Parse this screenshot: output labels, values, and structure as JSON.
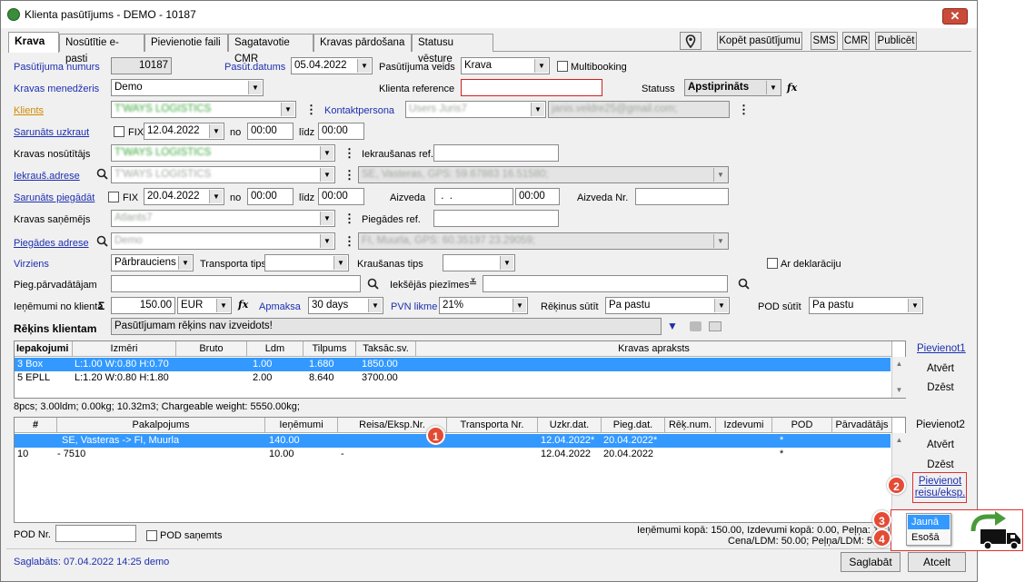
{
  "window": {
    "title": "Klienta pasūtījums - DEMO  - 10187",
    "close": "✕"
  },
  "tabs": [
    "Krava",
    "Nosūtītie e-pasti",
    "Pievienotie faili",
    "Sagatavotie CMR",
    "Kravas pārdošana",
    "Statusu vēsture"
  ],
  "toolbar": {
    "location_icon": "map-pin-icon",
    "copy": "Kopēt pasūtījumu",
    "sms": "SMS",
    "cmr": "CMR",
    "publish": "Publicēt"
  },
  "form": {
    "order_number_label": "Pasūtījuma numurs",
    "order_number": "10187",
    "order_date_label": "Pasūt.datums",
    "order_date": "05.04.2022",
    "order_type_label": "Pasūtījuma veids",
    "order_type": "Krava",
    "multibooking_label": "Multibooking",
    "manager_label": "Kravas menedžeris",
    "manager": "Demo",
    "client_ref_label": "Klienta reference",
    "client_ref": "",
    "status_label": "Statuss",
    "status": "Apstiprināts",
    "client_label": "Klients",
    "client": "T'WAYS LOGISTICS",
    "contact_label": "Kontaktpersona",
    "contact": "Users Juris7",
    "contact_email": "janis.veldre25@gmail.com;",
    "load_agreed_label": "Sarunāts uzkraut",
    "fix_label": "FIX",
    "load_date": "12.04.2022",
    "no_label": "no",
    "load_from": "00:00",
    "until_label": "līdz",
    "load_to": "00:00",
    "sender_label": "Kravas nosūtītājs",
    "sender": "T'WAYS LOGISTICS",
    "load_ref_label": "Iekraušanas ref.",
    "load_ref": "",
    "load_addr_label": "Iekrauš.adrese",
    "load_addr": "T'WAYS LOGISTICS",
    "load_addr_full": "SE, Vasteras, GPS: 59.67883 16.51580;",
    "deliver_agreed_label": "Sarunāts piegādāt",
    "deliver_date": "20.04.2022",
    "deliver_from": "00:00",
    "deliver_to": "00:00",
    "removed_label": "Aizveda",
    "removed_date": " .  .",
    "removed_time": "00:00",
    "removed_nr_label": "Aizveda Nr.",
    "removed_nr": "",
    "receiver_label": "Kravas saņēmējs",
    "receiver": "Atlants7",
    "delivery_ref_label": "Piegādes ref.",
    "delivery_ref": "",
    "delivery_addr_label": "Piegādes adrese",
    "delivery_addr": "Demo",
    "delivery_addr_full": "FI, Muurla, GPS: 60.35197 23.29059;",
    "direction_label": "Virziens",
    "direction": "Pārbrauciens",
    "transport_type_label": "Transporta tips",
    "transport_type": "",
    "loading_type_label": "Kraušanas tips",
    "loading_type": "",
    "declaration_label": "Ar deklarāciju",
    "carrier_label": "Pieg.pārvadātājam",
    "carrier": "",
    "internal_notes_label": "Iekšējās piezīmes",
    "internal_notes": "",
    "revenue_label": "Ieņēmumi no klienta",
    "sum_symbol": "Σ",
    "revenue": "150.00",
    "currency": "EUR",
    "fx": "fx",
    "payment_label": "Apmaksa",
    "payment": "30 days",
    "vat_label": "PVN likme",
    "vat": "21%",
    "invoice_send_label": "Rēķinus sūtīt",
    "invoice_send": "Pa pastu",
    "pod_send_label": "POD sūtīt",
    "pod_send": "Pa pastu",
    "invoice_label": "Rēķins klientam",
    "invoice_text": "Pasūtījumam rēķins nav izveidots!"
  },
  "packages": {
    "headers": [
      "Iepakojumi",
      "Izmēri",
      "Bruto",
      "Ldm",
      "Tilpums",
      "Taksāc.sv.",
      "Kravas apraksts"
    ],
    "rows": [
      [
        "3 Box",
        "L:1.00 W:0.80 H:0.70",
        "",
        "1.00",
        "1.680",
        "1850.00",
        ""
      ],
      [
        "5 EPLL",
        "L:1.20 W:0.80 H:1.80",
        "",
        "2.00",
        "8.640",
        "3700.00",
        ""
      ]
    ],
    "summary": "8pcs; 3.00ldm; 0.00kg; 10.32m3; Chargeable weight: 5550.00kg;",
    "add": "Pievienot1",
    "open": "Atvērt",
    "delete": "Dzēst"
  },
  "services": {
    "headers": [
      "#",
      "Pakalpojums",
      "Ieņēmumi",
      "Reisa/Eksp.Nr.",
      "Transporta Nr.",
      "Uzkr.dat.",
      "Pieg.dat.",
      "Rēķ.num.",
      "Izdevumi",
      "POD",
      "Pārvadātājs"
    ],
    "rows": [
      [
        "",
        "SE, Vasteras -> FI, Muurla",
        "140.00",
        "",
        "",
        "12.04.2022*",
        "20.04.2022*",
        "",
        "",
        "*",
        ""
      ],
      [
        "10",
        "- 7510",
        "10.00",
        "-",
        "",
        "12.04.2022",
        "20.04.2022",
        "",
        "",
        "*",
        ""
      ]
    ],
    "add": "Pievienot2",
    "open": "Atvērt",
    "delete": "Dzēst",
    "add_trip": "Pievienot reisu/eksp.",
    "menu_new": "Jaunā",
    "menu_existing": "Esošā"
  },
  "footer": {
    "pod_nr_label": "POD Nr.",
    "pod_nr": "",
    "pod_received_label": "POD saņemts",
    "totals1": "Ieņēmumi kopā: 150.00, Izdevumi kopā: 0.00, Peļņa: 150",
    "totals2": "Cena/LDM: 50.00; Peļņa/LDM: 50",
    "saved": "Saglabāts: 07.04.2022 14:25 demo",
    "save": "Saglabāt",
    "cancel": "Atcelt"
  },
  "badges": [
    "1",
    "2",
    "3",
    "4"
  ],
  "colors": {
    "link": "#1c2fb0",
    "selection": "#3399ff",
    "badge": "#e44b35",
    "highlight": "#e03030"
  }
}
